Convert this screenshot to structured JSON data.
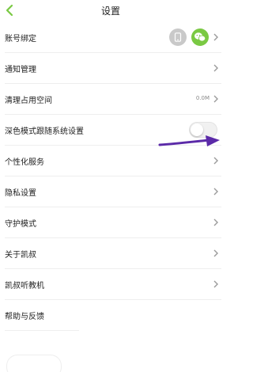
{
  "header": {
    "title": "设置"
  },
  "colors": {
    "accent": "#7ac943",
    "chevron": "#9a9a9a",
    "annotation_arrow": "#5b2aa8"
  },
  "icons": {
    "back": "chevron-left-icon",
    "chevron": "chevron-right-icon",
    "phone": "phone-icon",
    "wechat": "wechat-icon"
  },
  "rows": [
    {
      "label": "账号绑定"
    },
    {
      "label": "通知管理"
    },
    {
      "label": "清理占用空间",
      "value": "0.0M"
    },
    {
      "label": "深色模式跟随系统设置",
      "toggle_on": false
    },
    {
      "label": "个性化服务"
    },
    {
      "label": "隐私设置"
    },
    {
      "label": "守护模式"
    },
    {
      "label": "关于凯叔"
    },
    {
      "label": "凯叔听教机"
    },
    {
      "label": "帮助与反馈"
    }
  ]
}
